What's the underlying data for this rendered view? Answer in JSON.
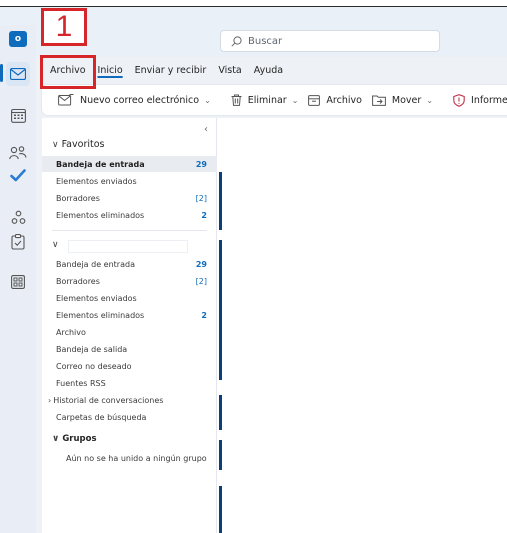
{
  "annotation": {
    "step_number": "1"
  },
  "app": {
    "logo_letter": "o"
  },
  "search": {
    "placeholder": "Buscar"
  },
  "menubar": {
    "tabs": [
      "Archivo",
      "Inicio",
      "Enviar y recibir",
      "Vista",
      "Ayuda"
    ]
  },
  "ribbon": {
    "new_mail": "Nuevo correo electrónico",
    "delete": "Eliminar",
    "archive": "Archivo",
    "move": "Mover",
    "report": "Informe"
  },
  "favorites": {
    "title": "Favoritos",
    "items": [
      {
        "label": "Bandeja de entrada",
        "count": "29"
      },
      {
        "label": "Elementos enviados",
        "count": ""
      },
      {
        "label": "Borradores",
        "count": "[2]"
      },
      {
        "label": "Elementos eliminados",
        "count": "2"
      }
    ]
  },
  "account": {
    "items": [
      {
        "label": "Bandeja de entrada",
        "count": "29"
      },
      {
        "label": "Borradores",
        "count": "[2]"
      },
      {
        "label": "Elementos enviados",
        "count": ""
      },
      {
        "label": "Elementos eliminados",
        "count": "2"
      },
      {
        "label": "Archivo",
        "count": ""
      },
      {
        "label": "Bandeja de salida",
        "count": ""
      },
      {
        "label": "Correo no deseado",
        "count": ""
      },
      {
        "label": "Fuentes RSS",
        "count": ""
      },
      {
        "label": "Historial de conversaciones",
        "count": ""
      },
      {
        "label": "Carpetas de búsqueda",
        "count": ""
      }
    ]
  },
  "groups": {
    "title": "Grupos",
    "empty_text": "Aún no se ha unido a ningún grupo"
  },
  "colors": {
    "accent": "#0f6cbd",
    "annotation": "#d6262a",
    "list_accent": "#0f3d78"
  }
}
